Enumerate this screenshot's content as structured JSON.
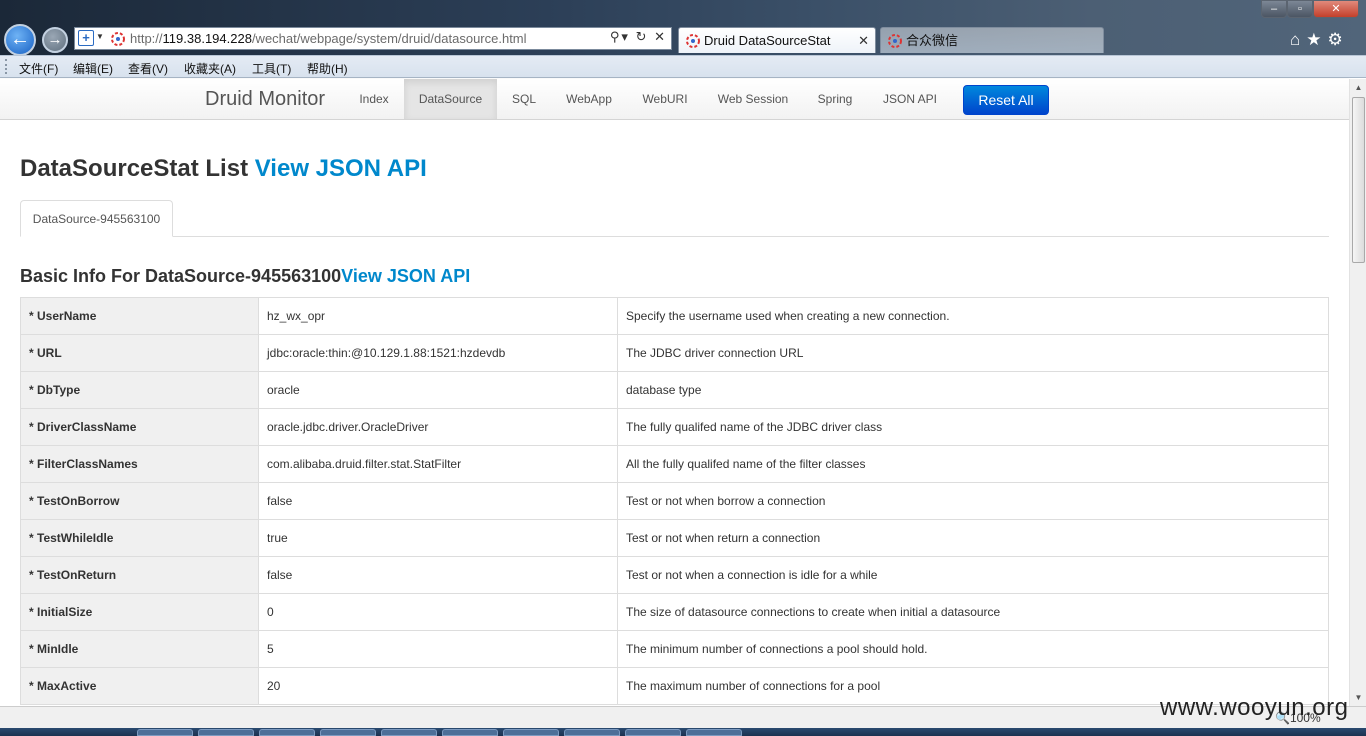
{
  "browser": {
    "address_url_prefix": "http://",
    "address_url_host": "119.38.194.228",
    "address_url_path": "/wechat/webpage/system/druid/datasource.html",
    "tabs": [
      {
        "label": "Druid DataSourceStat",
        "active": true,
        "close": "✕"
      },
      {
        "label": "合众微信",
        "active": false
      }
    ],
    "menu": [
      "文件(F)",
      "编辑(E)",
      "查看(V)",
      "收藏夹(A)",
      "工具(T)",
      "帮助(H)"
    ],
    "zoom": "100%"
  },
  "navbar": {
    "brand": "Druid Monitor",
    "links": [
      "Index",
      "DataSource",
      "SQL",
      "WebApp",
      "WebURI",
      "Web Session",
      "Spring",
      "JSON API"
    ],
    "active_link": "DataSource",
    "reset_label": "Reset All"
  },
  "page": {
    "title": "DataSourceStat List",
    "title_link": "View JSON API",
    "ds_tab": "DataSource-945563100",
    "basic_title": "Basic Info For DataSource-945563100",
    "basic_link": "View JSON API"
  },
  "rows": [
    {
      "key": "* UserName",
      "value": "hz_wx_opr",
      "desc": "Specify the username used when creating a new connection."
    },
    {
      "key": "* URL",
      "value": "jdbc:oracle:thin:@10.129.1.88:1521:hzdevdb",
      "desc": "The JDBC driver connection URL"
    },
    {
      "key": "* DbType",
      "value": "oracle",
      "desc": "database type"
    },
    {
      "key": "* DriverClassName",
      "value": "oracle.jdbc.driver.OracleDriver",
      "desc": "The fully qualifed name of the JDBC driver class"
    },
    {
      "key": "* FilterClassNames",
      "value": "com.alibaba.druid.filter.stat.StatFilter",
      "desc": "All the fully qualifed name of the filter classes"
    },
    {
      "key": "* TestOnBorrow",
      "value": "false",
      "desc": "Test or not when borrow a connection"
    },
    {
      "key": "* TestWhileIdle",
      "value": "true",
      "desc": "Test or not when return a connection"
    },
    {
      "key": "* TestOnReturn",
      "value": "false",
      "desc": "Test or not when a connection is idle for a while"
    },
    {
      "key": "* InitialSize",
      "value": "0",
      "desc": "The size of datasource connections to create when initial a datasource"
    },
    {
      "key": "* MinIdle",
      "value": "5",
      "desc": "The minimum number of connections a pool should hold."
    },
    {
      "key": "* MaxActive",
      "value": "20",
      "desc": "The maximum number of connections for a pool"
    }
  ],
  "watermark": "www.wooyun.org",
  "colors": {
    "accent": "#0088cc",
    "button": "#0055cc",
    "key_bg": "#f0f0f0"
  },
  "icons": [
    "back-arrow-icon",
    "forward-arrow-icon",
    "compat-view-icon",
    "druid-favicon",
    "search-icon",
    "refresh-icon",
    "stop-icon",
    "home-icon",
    "favorites-star-icon",
    "tools-gear-icon",
    "zoom-icon"
  ]
}
